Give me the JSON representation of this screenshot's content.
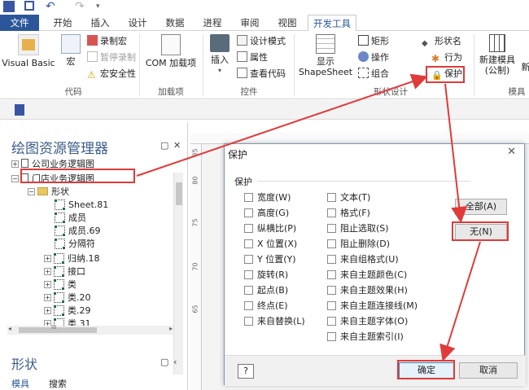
{
  "ribbon_tabs": [
    "文件",
    "开始",
    "插入",
    "设计",
    "数据",
    "进程",
    "审阅",
    "视图",
    "开发工具"
  ],
  "ribbon": {
    "code": {
      "visual_basic": "Visual Basic",
      "macro": "宏",
      "record_macro": "录制宏",
      "pause_recording": "暂停录制",
      "macro_security": "宏安全性",
      "label": "代码"
    },
    "addins": {
      "com": "COM 加载项",
      "label": "加载项"
    },
    "controls": {
      "insert": "插入",
      "design_mode": "设计模式",
      "properties": "属性",
      "view_code": "查看代码",
      "label": "控件"
    },
    "shape_design": {
      "show_shapesheet_1": "显示",
      "show_shapesheet_2": "ShapeSheet",
      "rectangle": "矩形",
      "operations": "操作",
      "group": "组合",
      "shape_name": "形状名",
      "behavior": "行为",
      "protection": "保护",
      "label": "形状设计"
    },
    "stencil": {
      "new_stencil_1": "新建模具",
      "new_stencil_2": "(公制)",
      "new_stencil_extra": "新",
      "label": "模具"
    }
  },
  "explorer": {
    "title": "绘图资源管理器",
    "items": [
      {
        "label": "公司业务逻辑图",
        "kind": "page",
        "level": 1,
        "expander": "+"
      },
      {
        "label": "门店业务逻辑图",
        "kind": "page",
        "level": 1,
        "expander": "−"
      },
      {
        "label": "形状",
        "kind": "folder",
        "level": 2,
        "expander": "−"
      },
      {
        "label": "Sheet.81",
        "kind": "shape",
        "level": 3
      },
      {
        "label": "成员",
        "kind": "shape",
        "level": 3
      },
      {
        "label": "成员.69",
        "kind": "shape",
        "level": 3
      },
      {
        "label": "分隔符",
        "kind": "shape",
        "level": 3
      },
      {
        "label": "归纳.18",
        "kind": "shape",
        "level": 3,
        "expander": "+"
      },
      {
        "label": "接口",
        "kind": "shape",
        "level": 3,
        "expander": "+"
      },
      {
        "label": "类",
        "kind": "shape",
        "level": 3,
        "expander": "+"
      },
      {
        "label": "类.20",
        "kind": "shape",
        "level": 3,
        "expander": "+"
      },
      {
        "label": "类.29",
        "kind": "shape",
        "level": 3,
        "expander": "+"
      },
      {
        "label": "类.31",
        "kind": "shape",
        "level": 3,
        "expander": "+"
      }
    ],
    "scroll_glyph": "III"
  },
  "shapes_panel": {
    "title": "形状",
    "tab_stencils": "模具",
    "tab_search": "搜索"
  },
  "ruler_ticks": [
    "85",
    "80",
    "75",
    "70",
    "65"
  ],
  "dialog": {
    "title": "保护",
    "group_label": "保护",
    "left_checks": [
      "宽度(W)",
      "高度(G)",
      "纵横比(P)",
      "X 位置(X)",
      "Y 位置(Y)",
      "旋转(R)",
      "起点(B)",
      "终点(E)",
      "来自替换(L)"
    ],
    "right_checks": [
      "文本(T)",
      "格式(F)",
      "阻止选取(S)",
      "阻止删除(D)",
      "来自组格式(U)",
      "来自主题颜色(C)",
      "来自主题效果(H)",
      "来自主题连接线(M)",
      "来自主题字体(O)",
      "来自主题索引(I)"
    ],
    "btn_all": "全部(A)",
    "btn_none": "无(N)",
    "btn_ok": "确定",
    "btn_cancel": "取消",
    "help": "?"
  },
  "colors": {
    "accent": "#2b579a",
    "annotation": "#e03a3a"
  }
}
